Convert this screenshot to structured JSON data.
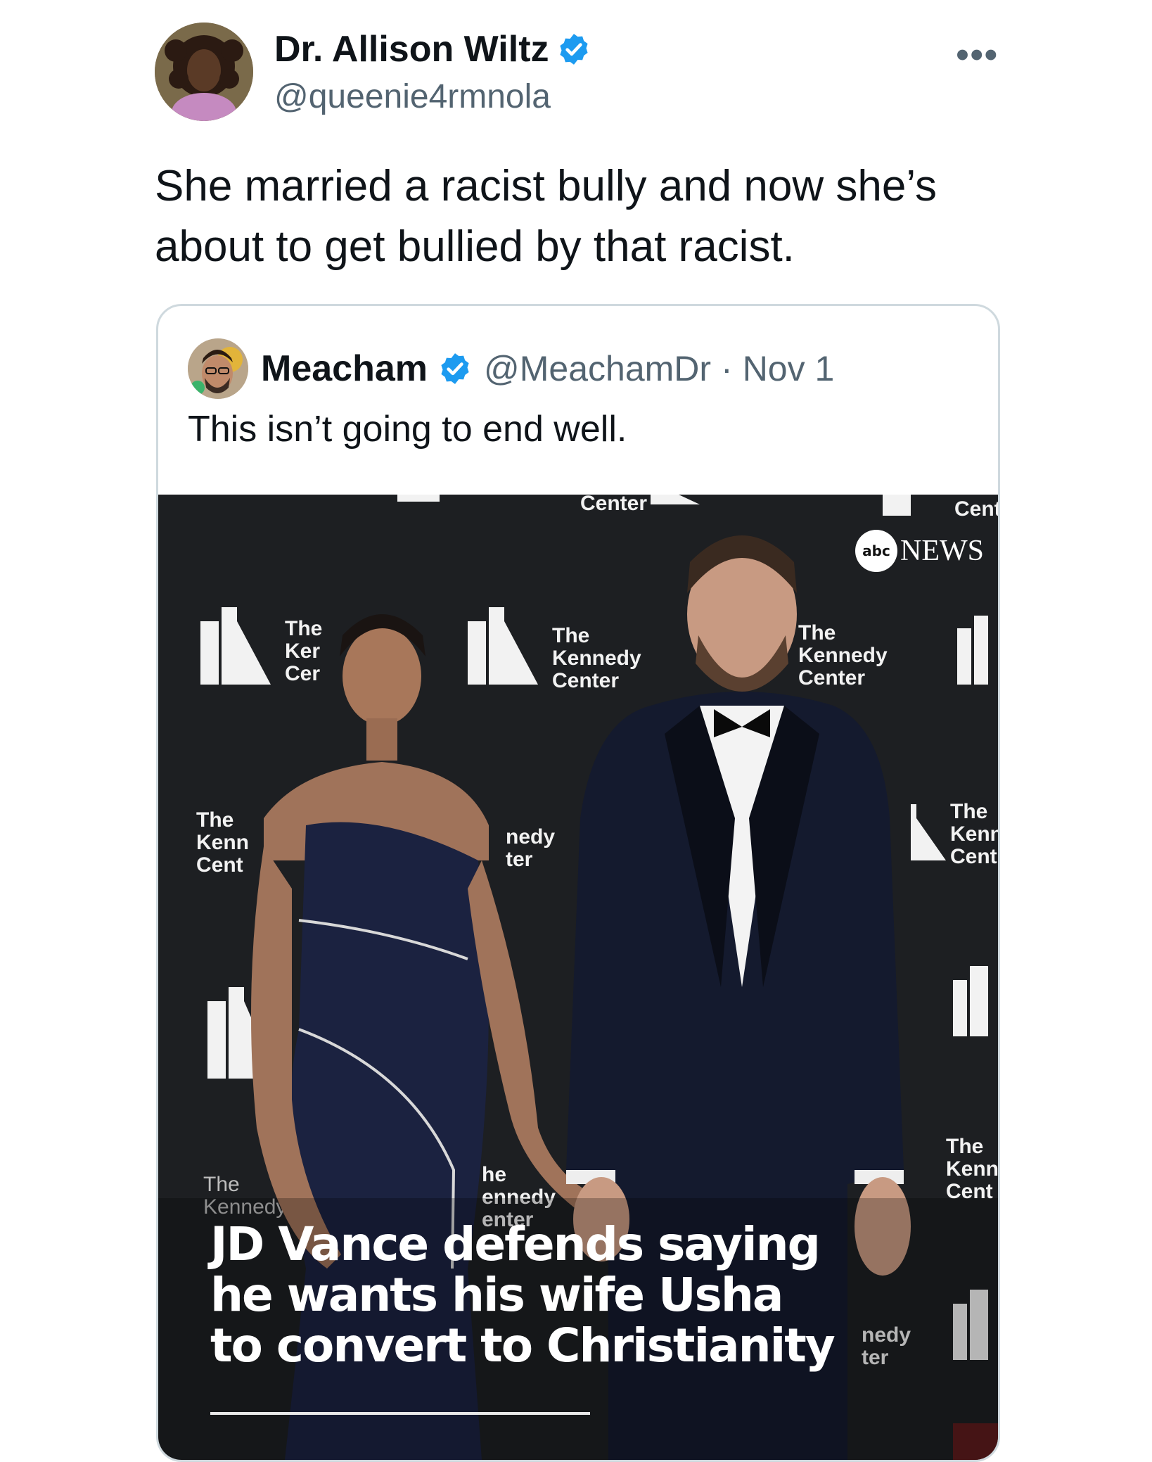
{
  "tweet": {
    "author_name": "Dr. Allison Wiltz",
    "author_handle": "@queenie4rmnola",
    "text": "She married a racist bully and now she’s about to get bullied by that racist.",
    "more_icon": "more-horizontal-icon"
  },
  "quote": {
    "author_name": "Meacham",
    "author_handle": "@MeachamDr",
    "separator": "·",
    "date": "Nov 1",
    "text": "This isn’t going to end well."
  },
  "media": {
    "headline": "JD Vance defends saying he wants his wife Usha to convert to Christianity",
    "logo_abc": "abc",
    "logo_news": "NEWS",
    "backdrop_texts": [
      "The",
      "Kennedy",
      "Center"
    ]
  },
  "colors": {
    "verified_blue": "#1d9bf0",
    "text_primary": "#0f1419",
    "text_secondary": "#536471",
    "border": "#cfd9de",
    "backdrop": "#1d1f22"
  }
}
